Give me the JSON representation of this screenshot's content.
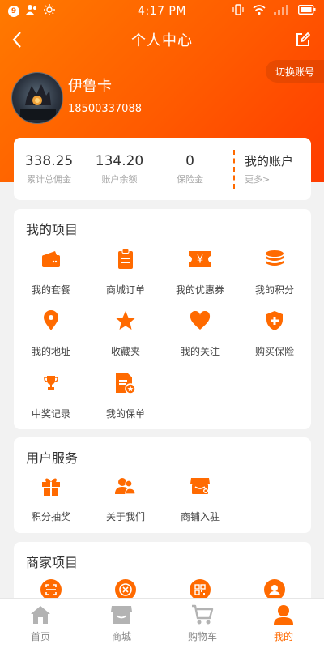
{
  "status_bar": {
    "badge": "9",
    "time": "4:17 PM"
  },
  "nav": {
    "title": "个人中心"
  },
  "switch_account": "切换账号",
  "profile": {
    "name": "伊鲁卡",
    "phone": "18500337088"
  },
  "stats": {
    "items": [
      {
        "value": "338.25",
        "label": "累计总佣金"
      },
      {
        "value": "134.20",
        "label": "账户余额"
      },
      {
        "value": "0",
        "label": "保险金"
      }
    ],
    "account": {
      "title": "我的账户",
      "more": "更多>"
    }
  },
  "sections": {
    "my_projects": {
      "title": "我的项目",
      "items": [
        {
          "label": "我的套餐",
          "icon": "wallet-icon"
        },
        {
          "label": "商城订单",
          "icon": "order-icon"
        },
        {
          "label": "我的优惠券",
          "icon": "coupon-icon"
        },
        {
          "label": "我的积分",
          "icon": "coins-icon"
        },
        {
          "label": "我的地址",
          "icon": "location-icon"
        },
        {
          "label": "收藏夹",
          "icon": "star-icon"
        },
        {
          "label": "我的关注",
          "icon": "heart-icon"
        },
        {
          "label": "购买保险",
          "icon": "shield-plus-icon"
        },
        {
          "label": "中奖记录",
          "icon": "trophy-icon"
        },
        {
          "label": "我的保单",
          "icon": "policy-doc-icon"
        }
      ]
    },
    "user_services": {
      "title": "用户服务",
      "items": [
        {
          "label": "积分抽奖",
          "icon": "gift-icon"
        },
        {
          "label": "关于我们",
          "icon": "people-icon"
        },
        {
          "label": "商铺入驻",
          "icon": "shop-icon"
        }
      ]
    },
    "merchant_projects": {
      "title": "商家项目",
      "items": [
        {
          "icon": "scan-icon"
        },
        {
          "icon": "cancel-circle-icon"
        },
        {
          "icon": "qrcode-icon"
        },
        {
          "icon": "user-circle-icon"
        }
      ]
    }
  },
  "tabbar": {
    "items": [
      {
        "label": "首页",
        "icon": "home-icon",
        "active": false
      },
      {
        "label": "商城",
        "icon": "store-icon",
        "active": false
      },
      {
        "label": "购物车",
        "icon": "cart-icon",
        "active": false
      },
      {
        "label": "我的",
        "icon": "person-icon",
        "active": true
      }
    ]
  },
  "colors": {
    "accent": "#ff6a00",
    "inactive": "#b3b3b3"
  }
}
